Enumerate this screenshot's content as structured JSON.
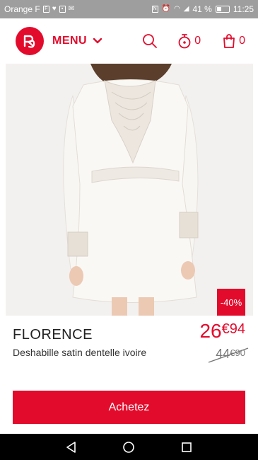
{
  "status_bar": {
    "carrier": "Orange F",
    "battery": "41 %",
    "battery_level": 0.41,
    "time": "11:25",
    "icons": [
      "sim-icon",
      "heart-icon",
      "photo-icon",
      "mail-icon",
      "nfc-icon",
      "alarm-icon",
      "wifi-icon",
      "signal-icon",
      "battery-icon"
    ]
  },
  "header": {
    "menu_label": "MENU",
    "timer_count": "0",
    "cart_count": "0"
  },
  "product": {
    "discount": "-40%",
    "name": "FLORENCE",
    "description": "Deshabille satin dentelle ivoire",
    "price_now_main": "26",
    "price_now_cents": "€94",
    "price_old_main": "44",
    "price_old_cents": "€90"
  },
  "cta": {
    "buy_label": "Achetez"
  },
  "colors": {
    "brand": "#e30b2c",
    "status_bar": "#9e9e9e",
    "nav_bar": "#000000"
  }
}
